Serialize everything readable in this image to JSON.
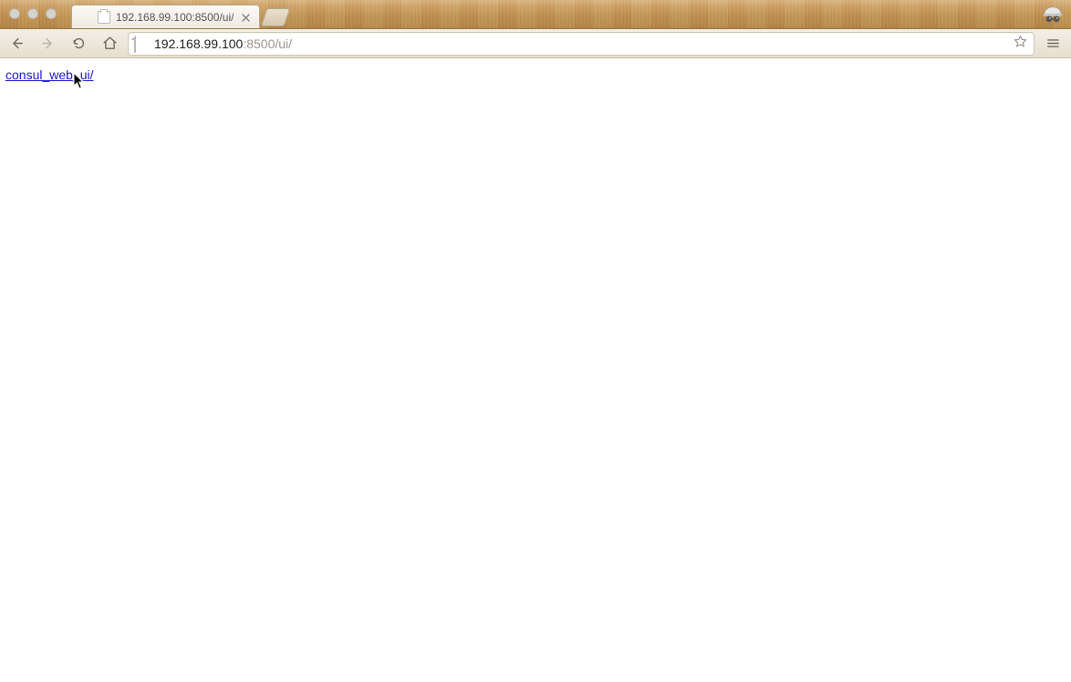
{
  "window": {
    "traffic_lights": [
      "close",
      "minimize",
      "zoom"
    ]
  },
  "tabs": {
    "active": {
      "title": "192.168.99.100:8500/ui/"
    }
  },
  "toolbar": {
    "url_strong": "192.168.99.100",
    "url_rest": ":8500/ui/"
  },
  "page": {
    "link_text": "consul_web_ui/"
  },
  "icons": {
    "back": "back-arrow-icon",
    "forward": "forward-arrow-icon",
    "reload": "reload-icon",
    "home": "home-icon",
    "page": "page-icon",
    "star": "star-icon",
    "menu": "hamburger-icon",
    "close_tab": "close-icon",
    "new_tab": "new-tab-icon",
    "incognito": "incognito-icon",
    "cursor": "cursor-icon"
  }
}
